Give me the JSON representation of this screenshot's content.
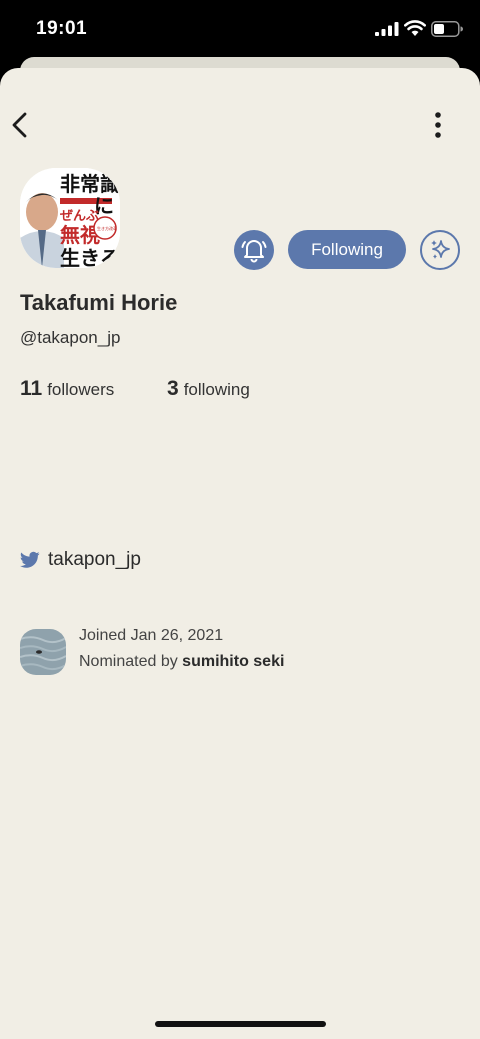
{
  "status_bar": {
    "time": "19:01"
  },
  "profile": {
    "name": "Takafumi Horie",
    "handle": "@takapon_jp",
    "followers_count": "11",
    "followers_label": "followers",
    "following_count": "3",
    "following_label": "following",
    "follow_button_label": "Following",
    "avatar_text": [
      "非常識",
      "に",
      "ぜんぶ",
      "無視",
      "生きろ",
      "生き方改革"
    ]
  },
  "links": {
    "twitter": "takapon_jp"
  },
  "joined": {
    "joined_text": "Joined Jan 26, 2021",
    "nominated_prefix": "Nominated by",
    "nominated_by": "sumihito seki"
  },
  "colors": {
    "accent": "#5c78ac",
    "background": "#f1eee5",
    "twitter": "#5c78ac"
  },
  "icons": [
    "back-arrow-icon",
    "more-vertical-icon",
    "bell-icon",
    "sparkles-icon",
    "twitter-icon"
  ]
}
